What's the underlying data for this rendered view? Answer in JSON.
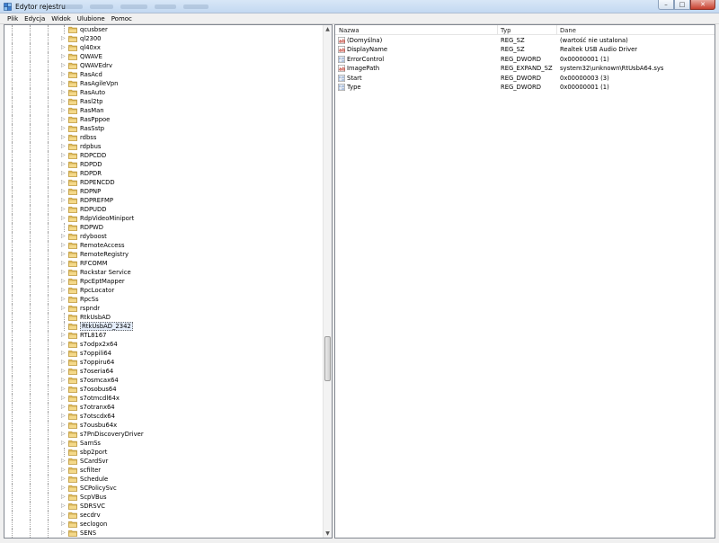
{
  "window": {
    "title": "Edytor rejestru",
    "buttons": {
      "minimize": "–",
      "maximize": "□",
      "close": "✕"
    }
  },
  "menu": [
    "Plik",
    "Edycja",
    "Widok",
    "Ulubione",
    "Pomoc"
  ],
  "tree": {
    "selected": "RtkUsbAD_2342",
    "items": [
      {
        "label": "qcusbser",
        "expandable": false
      },
      {
        "label": "ql2300",
        "expandable": true
      },
      {
        "label": "ql40xx",
        "expandable": true
      },
      {
        "label": "QWAVE",
        "expandable": true
      },
      {
        "label": "QWAVEdrv",
        "expandable": true
      },
      {
        "label": "RasAcd",
        "expandable": true
      },
      {
        "label": "RasAgileVpn",
        "expandable": true
      },
      {
        "label": "RasAuto",
        "expandable": true
      },
      {
        "label": "Rasl2tp",
        "expandable": true
      },
      {
        "label": "RasMan",
        "expandable": true
      },
      {
        "label": "RasPppoe",
        "expandable": true
      },
      {
        "label": "RasSstp",
        "expandable": true
      },
      {
        "label": "rdbss",
        "expandable": true
      },
      {
        "label": "rdpbus",
        "expandable": true
      },
      {
        "label": "RDPCDD",
        "expandable": true
      },
      {
        "label": "RDPDD",
        "expandable": true
      },
      {
        "label": "RDPDR",
        "expandable": true
      },
      {
        "label": "RDPENCDD",
        "expandable": true
      },
      {
        "label": "RDPNP",
        "expandable": true
      },
      {
        "label": "RDPREFMP",
        "expandable": true
      },
      {
        "label": "RDPUDD",
        "expandable": true
      },
      {
        "label": "RdpVideoMiniport",
        "expandable": true
      },
      {
        "label": "RDPWD",
        "expandable": false
      },
      {
        "label": "rdyboost",
        "expandable": true
      },
      {
        "label": "RemoteAccess",
        "expandable": true
      },
      {
        "label": "RemoteRegistry",
        "expandable": true
      },
      {
        "label": "RFCOMM",
        "expandable": true
      },
      {
        "label": "Rockstar Service",
        "expandable": true
      },
      {
        "label": "RpcEptMapper",
        "expandable": true
      },
      {
        "label": "RpcLocator",
        "expandable": true
      },
      {
        "label": "RpcSs",
        "expandable": true
      },
      {
        "label": "rspndr",
        "expandable": true
      },
      {
        "label": "RtkUsbAD",
        "expandable": false
      },
      {
        "label": "RtkUsbAD_2342",
        "expandable": false
      },
      {
        "label": "RTL8167",
        "expandable": true
      },
      {
        "label": "s7odpx2x64",
        "expandable": true
      },
      {
        "label": "s7oppili64",
        "expandable": true
      },
      {
        "label": "s7oppiru64",
        "expandable": true
      },
      {
        "label": "s7oseria64",
        "expandable": true
      },
      {
        "label": "s7osmcax64",
        "expandable": true
      },
      {
        "label": "s7osobus64",
        "expandable": true
      },
      {
        "label": "s7otmcdl64x",
        "expandable": true
      },
      {
        "label": "s7otranx64",
        "expandable": true
      },
      {
        "label": "s7otscdx64",
        "expandable": true
      },
      {
        "label": "s7ousbu64x",
        "expandable": true
      },
      {
        "label": "s7PnDiscoveryDriver",
        "expandable": true
      },
      {
        "label": "SamSs",
        "expandable": true
      },
      {
        "label": "sbp2port",
        "expandable": false
      },
      {
        "label": "SCardSvr",
        "expandable": true
      },
      {
        "label": "scfilter",
        "expandable": true
      },
      {
        "label": "Schedule",
        "expandable": true
      },
      {
        "label": "SCPolicySvc",
        "expandable": true
      },
      {
        "label": "ScpVBus",
        "expandable": true
      },
      {
        "label": "SDRSVC",
        "expandable": true
      },
      {
        "label": "secdrv",
        "expandable": true
      },
      {
        "label": "seclogon",
        "expandable": true
      },
      {
        "label": "SENS",
        "expandable": true
      }
    ]
  },
  "values": {
    "columns": [
      "Nazwa",
      "Typ",
      "Dane"
    ],
    "rows": [
      {
        "name": "(Domyślna)",
        "type": "REG_SZ",
        "data": "(wartość nie ustalona)",
        "icon": "string-value-icon"
      },
      {
        "name": "DisplayName",
        "type": "REG_SZ",
        "data": "Realtek USB Audio Driver",
        "icon": "string-value-icon"
      },
      {
        "name": "ErrorControl",
        "type": "REG_DWORD",
        "data": "0x00000001 (1)",
        "icon": "binary-value-icon"
      },
      {
        "name": "ImagePath",
        "type": "REG_EXPAND_SZ",
        "data": "system32\\unknown\\RtUsbA64.sys",
        "icon": "string-value-icon"
      },
      {
        "name": "Start",
        "type": "REG_DWORD",
        "data": "0x00000003 (3)",
        "icon": "binary-value-icon"
      },
      {
        "name": "Type",
        "type": "REG_DWORD",
        "data": "0x00000001 (1)",
        "icon": "binary-value-icon"
      }
    ]
  }
}
